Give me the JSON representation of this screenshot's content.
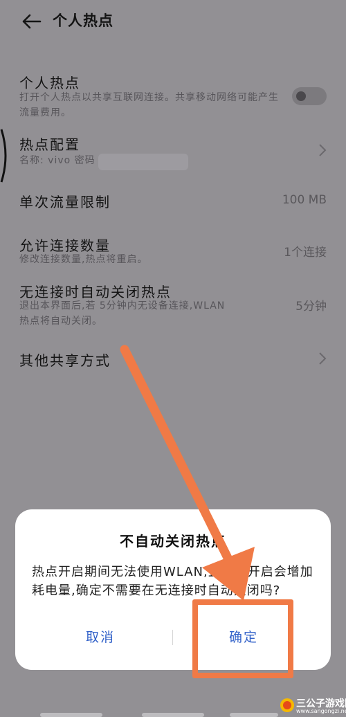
{
  "header": {
    "title": "个人热点"
  },
  "settings": {
    "hotspot": {
      "title": "个人热点",
      "description": "打开个人热点以共享互联网连接。共享移动网络可能产生流量费用。",
      "enabled": false
    },
    "config": {
      "title": "热点配置",
      "subtitle": "名称: vivo  密码"
    },
    "data_limit": {
      "title": "单次流量限制",
      "value": "100 MB"
    },
    "max_connections": {
      "title": "允许连接数量",
      "subtitle": "修改连接数量,热点将重启。",
      "value": "1个连接"
    },
    "auto_off": {
      "title": "无连接时自动关闭热点",
      "subtitle": "退出本界面后,若 5分钟内无设备连接,WLAN热点将自动关闭。",
      "value": "5分钟"
    },
    "other_sharing": {
      "title": "其他共享方式"
    }
  },
  "dialog": {
    "title": "不自动关闭热点",
    "message": "热点开启期间无法使用WLAN,且持续开启会增加耗电量,确定不需要在无连接时自动关闭吗?",
    "cancel_label": "取消",
    "confirm_label": "确定"
  },
  "watermark": {
    "text": "三公子游戏网",
    "url": "www.sangongzi.net"
  },
  "colors": {
    "accent": "#2f5fc8",
    "annotation": "#f07a46",
    "scrim": "#929094"
  }
}
